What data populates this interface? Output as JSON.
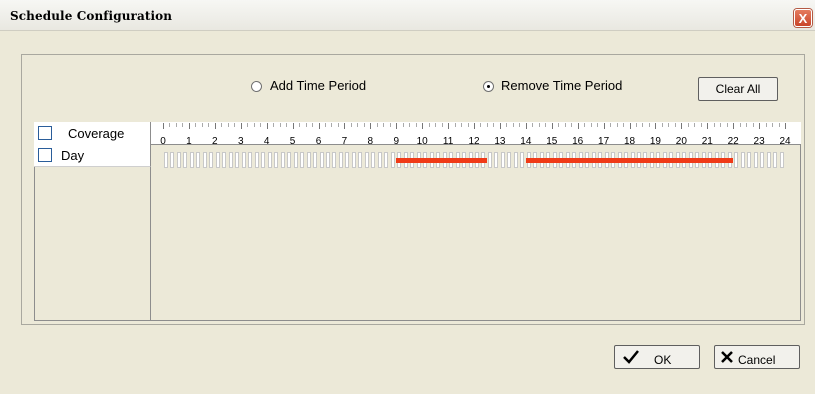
{
  "window": {
    "title": "Schedule Configuration",
    "close_glyph": "X"
  },
  "mode": {
    "add_label": "Add Time Period",
    "remove_label": "Remove Time Period",
    "selected": "remove"
  },
  "toolbar": {
    "clear_all_label": "Clear All"
  },
  "grid": {
    "header_label": "Coverage",
    "row_label": "Day",
    "hours": [
      "0",
      "1",
      "2",
      "3",
      "4",
      "5",
      "6",
      "7",
      "8",
      "9",
      "10",
      "11",
      "12",
      "13",
      "14",
      "15",
      "16",
      "17",
      "18",
      "19",
      "20",
      "21",
      "22",
      "23",
      "24"
    ],
    "scheduled_periods": [
      {
        "start": 9.0,
        "end": 12.5
      },
      {
        "start": 14.0,
        "end": 22.0
      }
    ],
    "bar_color": "#f03a17"
  },
  "footer": {
    "ok_label": "OK",
    "cancel_label": "Cancel",
    "ok_icon": "checkmark-icon",
    "cancel_icon": "x-icon"
  }
}
